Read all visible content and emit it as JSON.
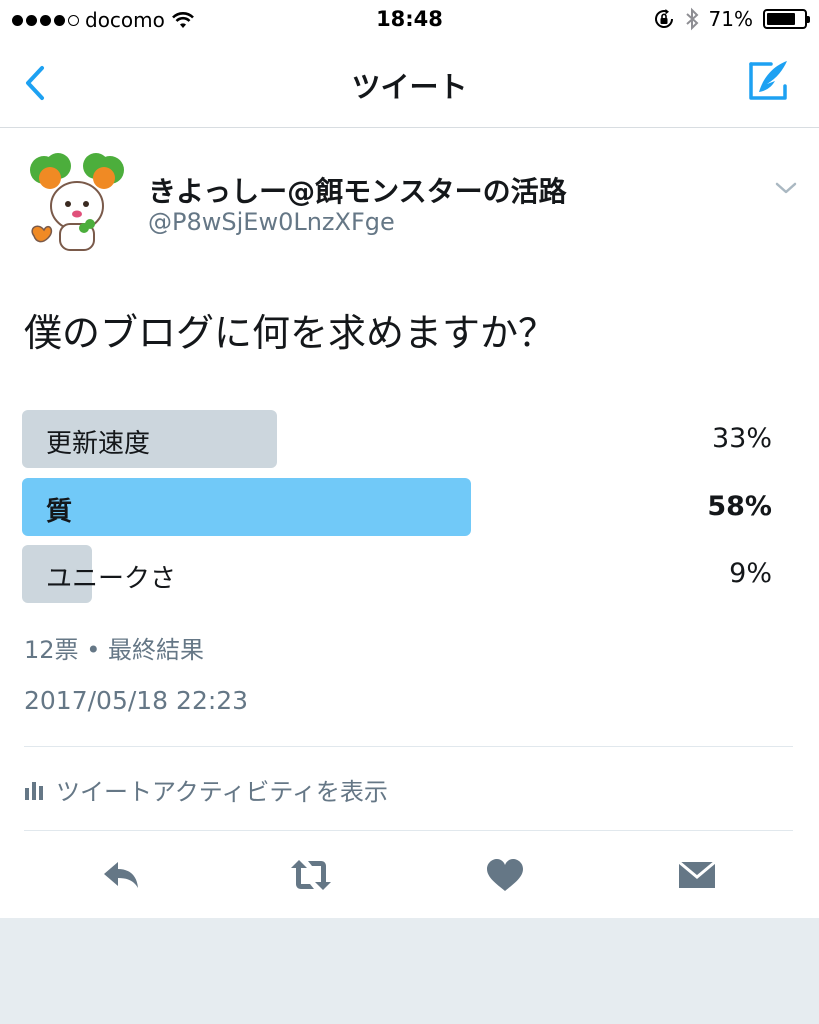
{
  "status_bar": {
    "carrier": "docomo",
    "time": "18:48",
    "battery": "71%",
    "battery_level": 0.71
  },
  "nav": {
    "title": "ツイート",
    "back_icon": "chevron-left-icon",
    "compose_icon": "compose-icon"
  },
  "tweet": {
    "name": "きよっしー@餌モンスターの活路",
    "handle": "@P8wSjEw0LnzXFge",
    "text": "僕のブログに何を求めますか？",
    "timestamp": "2017/05/18 22:23"
  },
  "poll": {
    "options": [
      {
        "label": "更新速度",
        "percent": "33%",
        "value": 33,
        "winner": false
      },
      {
        "label": "質",
        "percent": "58%",
        "value": 58,
        "winner": true
      },
      {
        "label": "ユニークさ",
        "percent": "9%",
        "value": 9,
        "winner": false
      }
    ],
    "votes": "12票",
    "separator": "•",
    "status": "最終結果"
  },
  "activity": {
    "label": "ツイートアクティビティを表示"
  },
  "actions": [
    "reply-icon",
    "retweet-icon",
    "like-icon",
    "dm-icon"
  ],
  "colors": {
    "accent": "#1da1f2",
    "winner_bar": "#71c9f8",
    "bar": "#ccd6dd",
    "muted": "#657786"
  }
}
